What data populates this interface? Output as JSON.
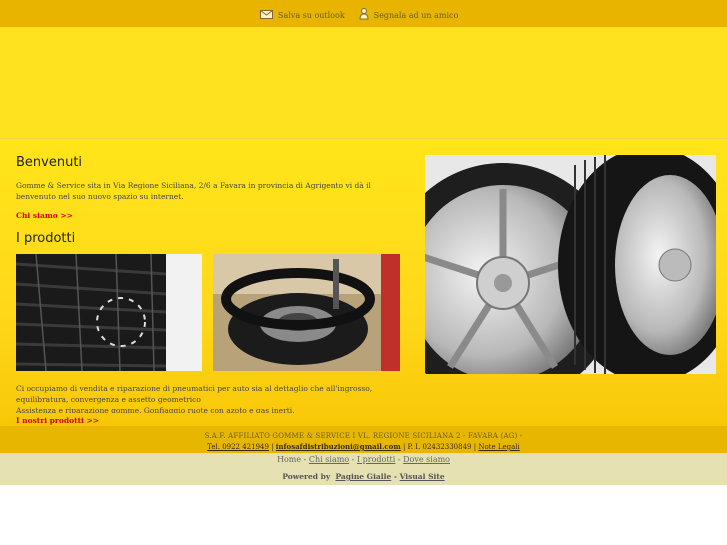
{
  "topbar": {
    "save_label": "Salva su outlook",
    "report_label": "Segnala ad un amico",
    "save_icon": "mail-icon",
    "report_icon": "person-icon"
  },
  "welcome": {
    "title": "Benvenuti",
    "text": "Gomme & Service sita in Via Regione Siciliana, 2/6 a Favara in provincia di Agrigento vi dà il benvenuto nel suo nuovo spazio su internet.",
    "link": "Chi siamo >>"
  },
  "products": {
    "title": "I prodotti",
    "description": "Ci occupiamo di vendita e riparazione di pneumatici per auto sia al dettaglio che all'ingrosso, equilibratura, convergenza e assetto geometrico",
    "description2": "Assistenza e riparazione gomme. Gonfiaggio ruote con azoto e gas inerti.",
    "link": "I nostri prodotti >>"
  },
  "footer": {
    "line1": "S.A.F. AFFILIATO GOMME & SERVICE I VL. REGIONE SICILIANA 2 - FAVARA (AG) -",
    "phone": "Tel. 0922 421949",
    "sep1": " | ",
    "email": "infosafdistribuzioni@gmail.com",
    "piva": " | P. I. 02432330849 | ",
    "legal": "Note Legali"
  },
  "nav": {
    "home": "Home",
    "sep": " - ",
    "about": "Chi siamo",
    "products": "I prodotti",
    "where": "Dove siamo",
    "powered_by": "Powered by",
    "pagine_gialle": "Pagine Gialle",
    "dash": " - ",
    "visual_site": "Visual Site"
  },
  "colors": {
    "topbar": "#e8b400",
    "banner": "#ffe21f",
    "link_red": "#d40000",
    "nav_bg": "#e5e1b2"
  }
}
